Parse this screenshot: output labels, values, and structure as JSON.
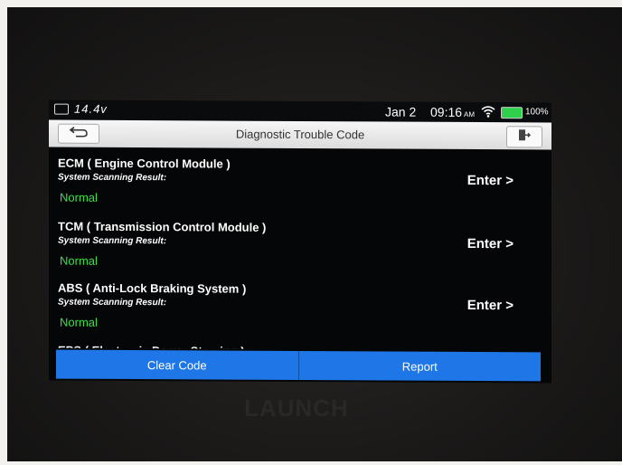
{
  "status_bar": {
    "voltage": "14.4v",
    "date": "Jan 2",
    "time": "09:16",
    "ampm": "AM",
    "battery_percent": "100%"
  },
  "title_bar": {
    "title": "Diagnostic Trouble Code"
  },
  "modules": [
    {
      "name": "ECM ( Engine Control Module )",
      "scan_label": "System Scanning Result:",
      "status": "Normal",
      "enter_label": "Enter >"
    },
    {
      "name": "TCM ( Transmission Control Module )",
      "scan_label": "System Scanning Result:",
      "status": "Normal",
      "enter_label": "Enter >"
    },
    {
      "name": "ABS ( Anti-Lock Braking System )",
      "scan_label": "System Scanning Result:",
      "status": "Normal",
      "enter_label": "Enter >"
    }
  ],
  "partial_module": "EPS ( Electronic Power Steering )",
  "actions": {
    "clear_code": "Clear Code",
    "report": "Report"
  },
  "device_brand": "LAUNCH",
  "colors": {
    "status_green": "#3ee04a",
    "action_blue": "#1f76e6",
    "battery_green": "#2fd14c"
  }
}
